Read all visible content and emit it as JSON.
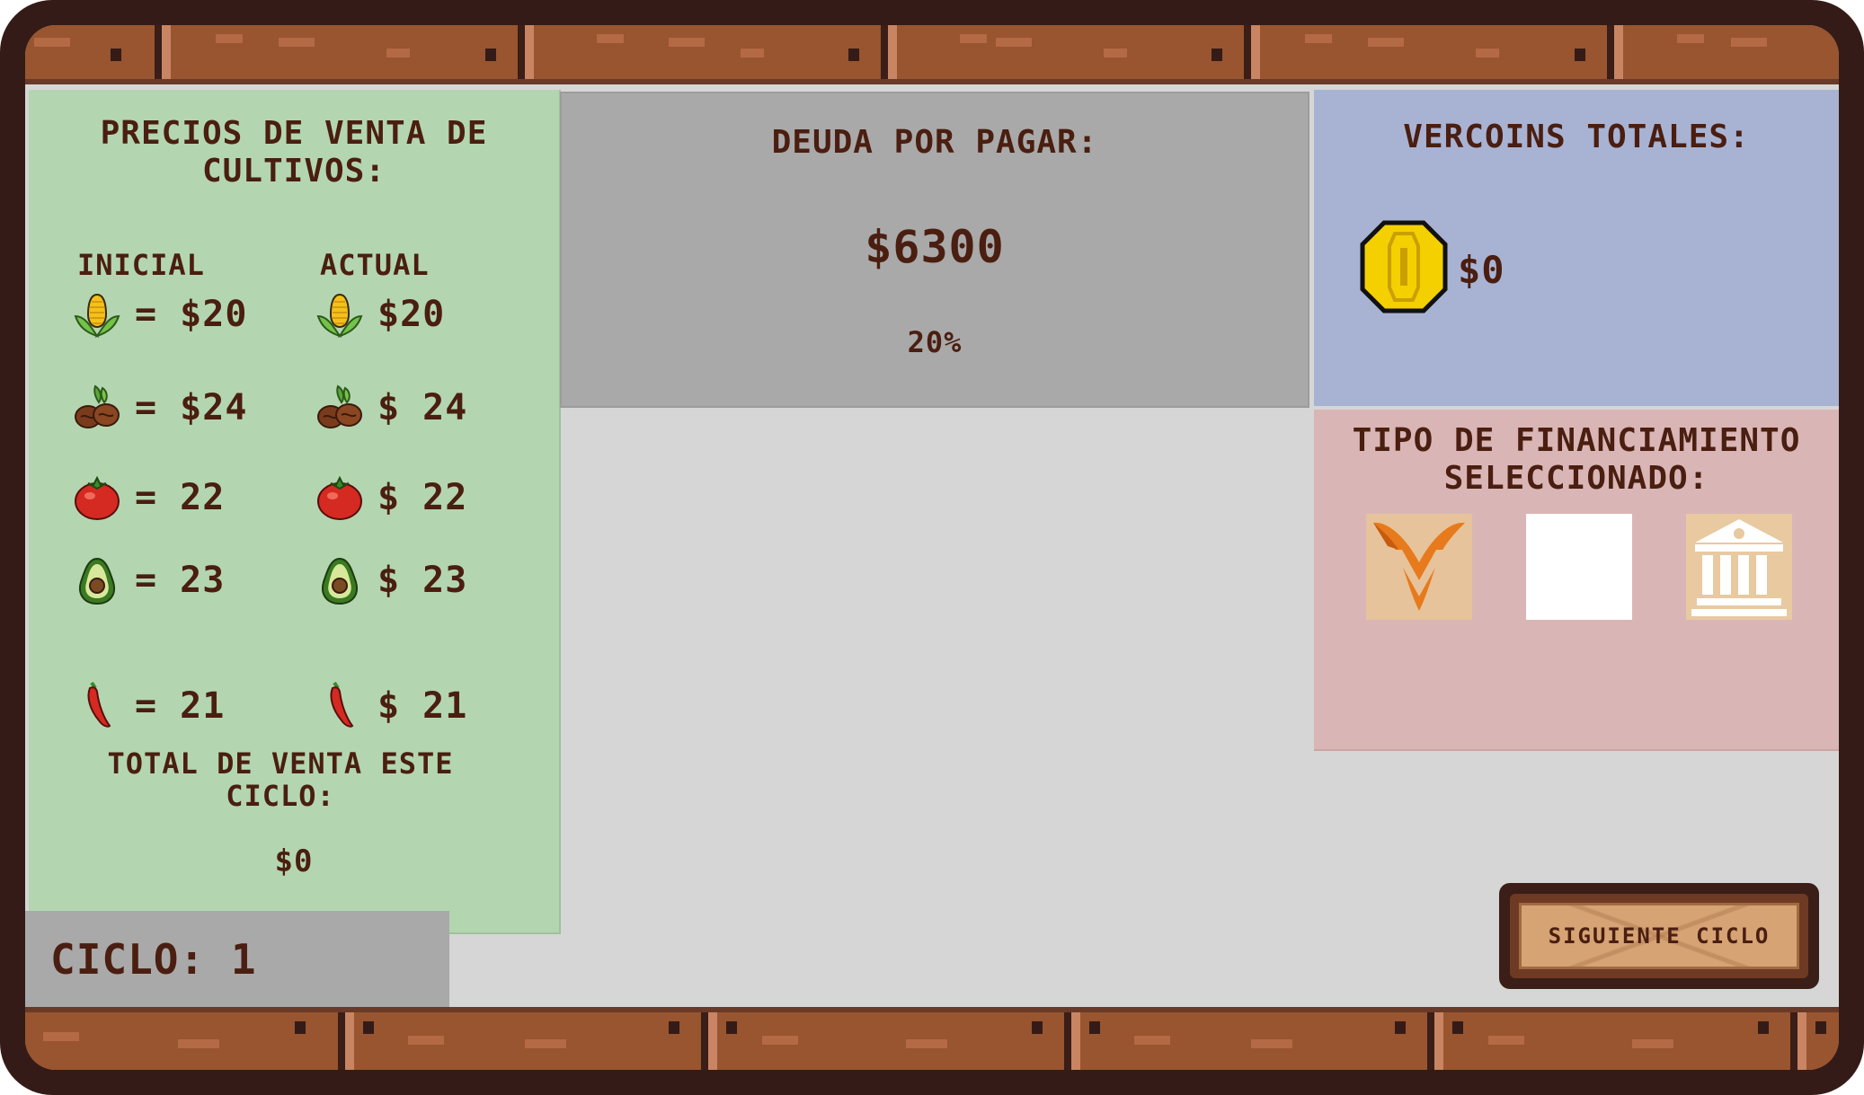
{
  "prices_panel": {
    "title": "PRECIOS DE VENTA DE CULTIVOS:",
    "col_initial": "INICIAL",
    "col_current": "ACTUAL",
    "crops": [
      {
        "icon": "corn-icon",
        "initial": "= $20",
        "current": "$20"
      },
      {
        "icon": "coffee-beans-icon",
        "initial": "= $24",
        "current": "$ 24"
      },
      {
        "icon": "tomato-icon",
        "initial": "= 22",
        "current": "$ 22"
      },
      {
        "icon": "avocado-icon",
        "initial": "= 23",
        "current": "$ 23"
      },
      {
        "icon": "chili-pepper-icon",
        "initial": "= 21",
        "current": "$ 21"
      }
    ],
    "total_label": "TOTAL DE VENTA ESTE CICLO:",
    "total_value": "$0"
  },
  "debt_panel": {
    "title": "DEUDA POR PAGAR:",
    "amount": "$6300",
    "rate": "20%"
  },
  "coins_panel": {
    "title": "VERCOINS TOTALES:",
    "icon": "gold-coin-icon",
    "amount": "$0"
  },
  "finance_panel": {
    "title": "TIPO DE FINANCIAMIENTO SELECCIONADO:",
    "options": [
      "v-brand-logo-icon",
      "blank-option",
      "bank-building-icon"
    ]
  },
  "cycle": {
    "label": "CICLO: 1"
  },
  "next_button": {
    "label": "SIGUIENTE CICLO"
  },
  "colors": {
    "frame": "#351b17",
    "brick": "#98552f",
    "text": "#4a1e10",
    "prices_bg": "#b3d6b1",
    "debt_bg": "#a9a9a9",
    "coins_bg": "#a8b3d4",
    "finance_bg": "#d9b6b5",
    "coin": "#f5d000"
  }
}
